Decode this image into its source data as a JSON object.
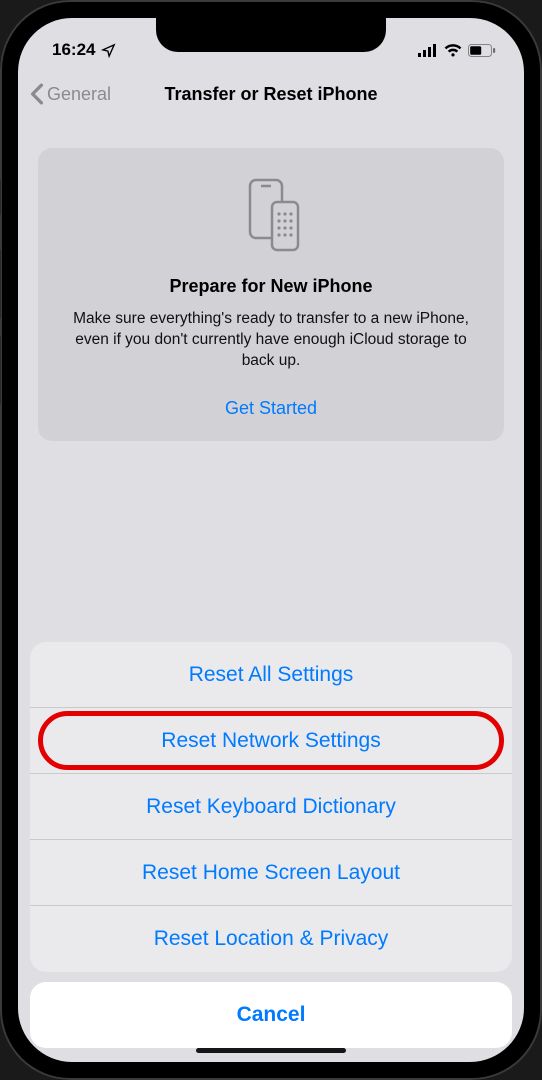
{
  "status": {
    "time": "16:24"
  },
  "nav": {
    "back_label": "General",
    "title": "Transfer or Reset iPhone"
  },
  "card": {
    "title": "Prepare for New iPhone",
    "desc": "Make sure everything's ready to transfer to a new iPhone, even if you don't currently have enough iCloud storage to back up.",
    "cta": "Get Started"
  },
  "sheet": {
    "items": [
      {
        "label": "Reset All Settings"
      },
      {
        "label": "Reset Network Settings"
      },
      {
        "label": "Reset Keyboard Dictionary"
      },
      {
        "label": "Reset Home Screen Layout"
      },
      {
        "label": "Reset Location & Privacy"
      }
    ],
    "cancel": "Cancel"
  }
}
